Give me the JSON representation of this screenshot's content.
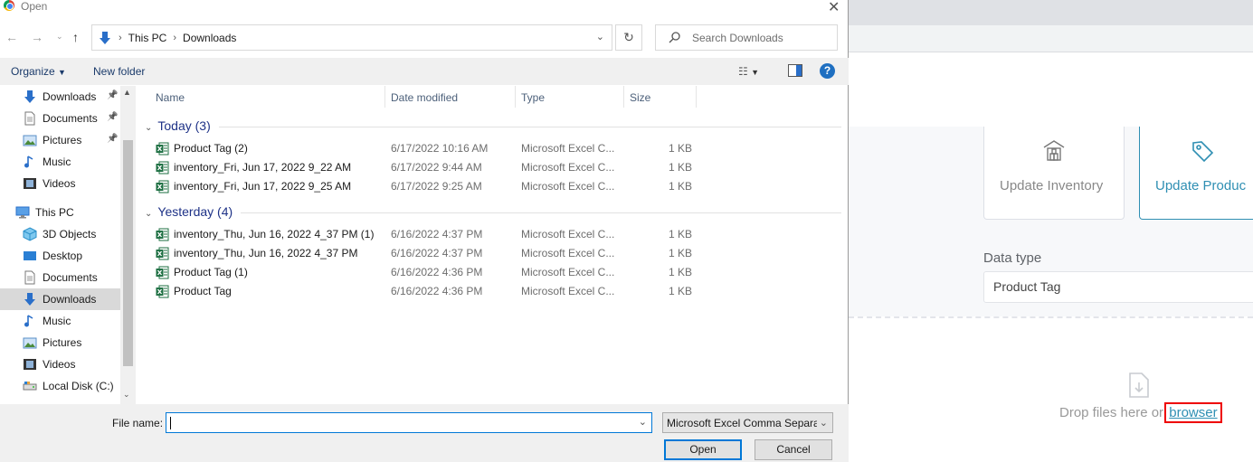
{
  "dialog": {
    "title": "Open",
    "breadcrumb": [
      "This PC",
      "Downloads"
    ],
    "search_placeholder": "Search Downloads",
    "toolbar": {
      "organize": "Organize",
      "new_folder": "New folder"
    },
    "nav": [
      {
        "label": "Downloads",
        "icon": "download-arrow-icon",
        "pinned": true
      },
      {
        "label": "Documents",
        "icon": "document-icon",
        "pinned": true
      },
      {
        "label": "Pictures",
        "icon": "pictures-icon",
        "pinned": true
      },
      {
        "label": "Music",
        "icon": "music-icon",
        "pinned": false
      },
      {
        "label": "Videos",
        "icon": "videos-icon",
        "pinned": false
      },
      {
        "label": "This PC",
        "icon": "computer-icon",
        "pinned": false
      },
      {
        "label": "3D Objects",
        "icon": "cube-icon",
        "pinned": false
      },
      {
        "label": "Desktop",
        "icon": "desktop-icon",
        "pinned": false
      },
      {
        "label": "Documents",
        "icon": "document-icon",
        "pinned": false
      },
      {
        "label": "Downloads",
        "icon": "download-arrow-icon",
        "pinned": false,
        "selected": true
      },
      {
        "label": "Music",
        "icon": "music-icon",
        "pinned": false
      },
      {
        "label": "Pictures",
        "icon": "pictures-icon",
        "pinned": false
      },
      {
        "label": "Videos",
        "icon": "videos-icon",
        "pinned": false
      },
      {
        "label": "Local Disk (C:)",
        "icon": "disk-icon",
        "pinned": false
      }
    ],
    "columns": {
      "name": "Name",
      "date": "Date modified",
      "type": "Type",
      "size": "Size"
    },
    "groups": [
      {
        "label": "Today (3)",
        "files": [
          {
            "name": "Product Tag (2)",
            "date": "6/17/2022 10:16 AM",
            "type": "Microsoft Excel C...",
            "size": "1 KB"
          },
          {
            "name": "inventory_Fri, Jun 17, 2022 9_22 AM",
            "date": "6/17/2022 9:44 AM",
            "type": "Microsoft Excel C...",
            "size": "1 KB"
          },
          {
            "name": "inventory_Fri, Jun 17, 2022 9_25 AM",
            "date": "6/17/2022 9:25 AM",
            "type": "Microsoft Excel C...",
            "size": "1 KB"
          }
        ]
      },
      {
        "label": "Yesterday (4)",
        "files": [
          {
            "name": "inventory_Thu, Jun 16, 2022 4_37 PM (1)",
            "date": "6/16/2022 4:37 PM",
            "type": "Microsoft Excel C...",
            "size": "1 KB"
          },
          {
            "name": "inventory_Thu, Jun 16, 2022 4_37 PM",
            "date": "6/16/2022 4:37 PM",
            "type": "Microsoft Excel C...",
            "size": "1 KB"
          },
          {
            "name": "Product Tag (1)",
            "date": "6/16/2022 4:36 PM",
            "type": "Microsoft Excel C...",
            "size": "1 KB"
          },
          {
            "name": "Product Tag",
            "date": "6/16/2022 4:36 PM",
            "type": "Microsoft Excel C...",
            "size": "1 KB"
          }
        ]
      }
    ],
    "file_name_label": "File name:",
    "file_name_value": "",
    "file_type": "Microsoft Excel Comma Separa",
    "open_label": "Open",
    "cancel_label": "Cancel"
  },
  "background": {
    "cards": [
      {
        "label": "Update Inventory",
        "icon": "warehouse-icon"
      },
      {
        "label": "Update Produc",
        "icon": "tag-icon"
      }
    ],
    "data_type_label": "Data type",
    "data_type_value": "Product Tag",
    "drop_text": "Drop files here or",
    "browse_link": "browser"
  },
  "colors": {
    "accent": "#2f8fb3",
    "dialog_blue": "#0078d7",
    "highlight_box": "#e00000",
    "excel_green": "#1d6f42"
  }
}
